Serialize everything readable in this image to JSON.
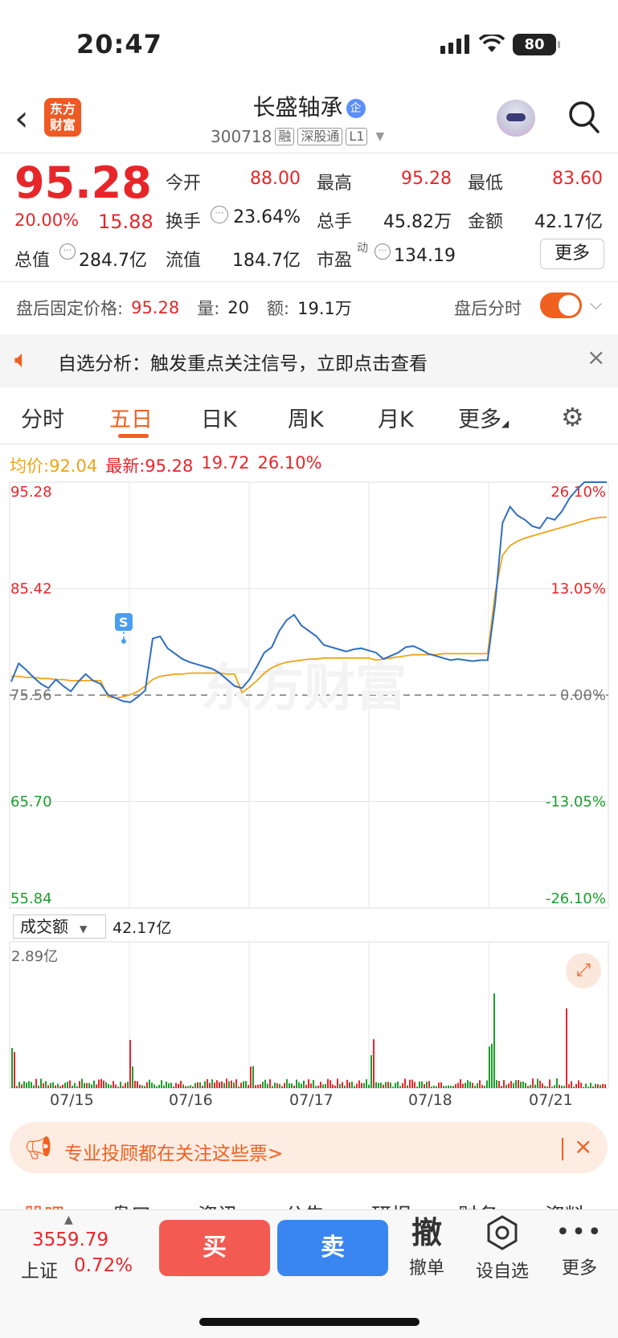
{
  "status": {
    "time": "20:47",
    "battery": "80"
  },
  "header": {
    "logo": "东方\n财富",
    "title": "长盛轴承",
    "title_badge": "企",
    "code": "300718",
    "tags": [
      "融",
      "深股通",
      "L1"
    ]
  },
  "quote": {
    "price": "95.28",
    "change_pct": "20.00%",
    "change": "15.88",
    "open_label": "今开",
    "open": "88.00",
    "high_label": "最高",
    "high": "95.28",
    "low_label": "最低",
    "low": "83.60",
    "turnover_label": "换手",
    "turnover": "23.64%",
    "volume_label": "总手",
    "volume": "45.82万",
    "amount_label": "金额",
    "amount": "42.17亿",
    "mktcap_label": "总值",
    "mktcap": "284.7亿",
    "float_label": "流值",
    "float_cap": "184.7亿",
    "pe_label": "市盈",
    "pe_sup": "动",
    "pe": "134.19",
    "more_button": "更多"
  },
  "after_hours": {
    "price_label": "盘后固定价格:",
    "price": "95.28",
    "vol_label": "量:",
    "vol": "20",
    "amt_label": "额:",
    "amt": "19.1万",
    "toggle_label": "盘后分时"
  },
  "alert": {
    "text": "自选分析：触发重点关注信号，立即点击查看"
  },
  "tabs": [
    "分时",
    "五日",
    "日K",
    "周K",
    "月K",
    "更多"
  ],
  "active_tab": "五日",
  "legend": {
    "avg_label": "均价:",
    "avg": "92.04",
    "last_label": "最新:",
    "last": "95.28",
    "last_change": "19.72",
    "last_pct": "26.10%"
  },
  "chart_data": {
    "type": "line",
    "title": "",
    "x": [
      "07/15",
      "07/16",
      "07/17",
      "07/18",
      "07/21"
    ],
    "y_ticks_left": [
      "95.28",
      "85.42",
      "75.56",
      "65.70",
      "55.84"
    ],
    "y_ticks_right": [
      "26.10%",
      "13.05%",
      "0.00%",
      "-13.05%",
      "-26.10%"
    ],
    "ylim": [
      55.84,
      95.28
    ],
    "baseline": 75.56,
    "series": [
      {
        "name": "最新",
        "color": "#2f6fc0",
        "values": [
          76.8,
          78.5,
          77.9,
          77.2,
          76.6,
          76.2,
          77.0,
          76.4,
          75.9,
          76.8,
          77.5,
          76.9,
          76.6,
          75.6,
          75.3,
          75.0,
          74.9,
          75.4,
          76.0,
          80.8,
          81.0,
          79.9,
          79.4,
          78.9,
          78.6,
          78.4,
          78.2,
          78.0,
          77.6,
          77.0,
          76.4,
          76.2,
          77.0,
          78.2,
          79.5,
          80.0,
          81.5,
          82.5,
          83.0,
          82.0,
          81.5,
          81.0,
          80.2,
          80.0,
          79.8,
          79.6,
          79.8,
          79.9,
          79.7,
          79.5,
          78.9,
          79.2,
          79.5,
          80.0,
          80.1,
          79.8,
          79.4,
          79.2,
          79.0,
          78.8,
          78.9,
          78.8,
          78.7,
          78.8,
          78.8,
          84.0,
          91.5,
          93.0,
          92.2,
          91.8,
          91.2,
          91.0,
          92.0,
          91.8,
          92.6,
          93.8,
          94.6,
          95.28,
          95.28,
          95.28,
          95.28
        ]
      },
      {
        "name": "均价",
        "color": "#f0a318",
        "values": [
          77.3,
          77.3,
          77.2,
          77.2,
          77.1,
          77.1,
          77.0,
          77.0,
          76.9,
          76.9,
          76.9,
          76.9,
          76.9,
          75.4,
          75.3,
          75.4,
          75.6,
          75.9,
          76.4,
          77.0,
          77.3,
          77.4,
          77.5,
          77.5,
          77.6,
          77.6,
          77.6,
          77.6,
          77.6,
          77.5,
          77.5,
          75.8,
          76.3,
          76.9,
          77.6,
          78.1,
          78.4,
          78.6,
          78.7,
          78.8,
          78.9,
          78.9,
          79.0,
          79.0,
          79.0,
          79.0,
          79.0,
          79.0,
          79.0,
          78.8,
          78.9,
          79.0,
          79.1,
          79.2,
          79.3,
          79.3,
          79.3,
          79.3,
          79.4,
          79.4,
          79.4,
          79.4,
          79.4,
          79.4,
          79.4,
          85.0,
          88.5,
          89.4,
          89.8,
          90.1,
          90.3,
          90.5,
          90.7,
          90.9,
          91.1,
          91.3,
          91.5,
          91.7,
          91.9,
          92.0,
          92.04
        ]
      }
    ],
    "volume": {
      "label": "成交额",
      "total": "42.17亿",
      "max": "2.89亿"
    }
  },
  "promo": {
    "text": "专业投顾都在关注这些票>"
  },
  "section_tabs": [
    "股吧",
    "盘口",
    "资讯",
    "公告",
    "研报",
    "财务",
    "资料"
  ],
  "bottom": {
    "index_value": "3559.79",
    "index_name": "上证",
    "index_pct": "0.72%",
    "buy": "买",
    "sell": "卖",
    "cancel_icon": "撤",
    "cancel_label": "撤单",
    "watch_label": "设自选",
    "more_label": "更多"
  }
}
